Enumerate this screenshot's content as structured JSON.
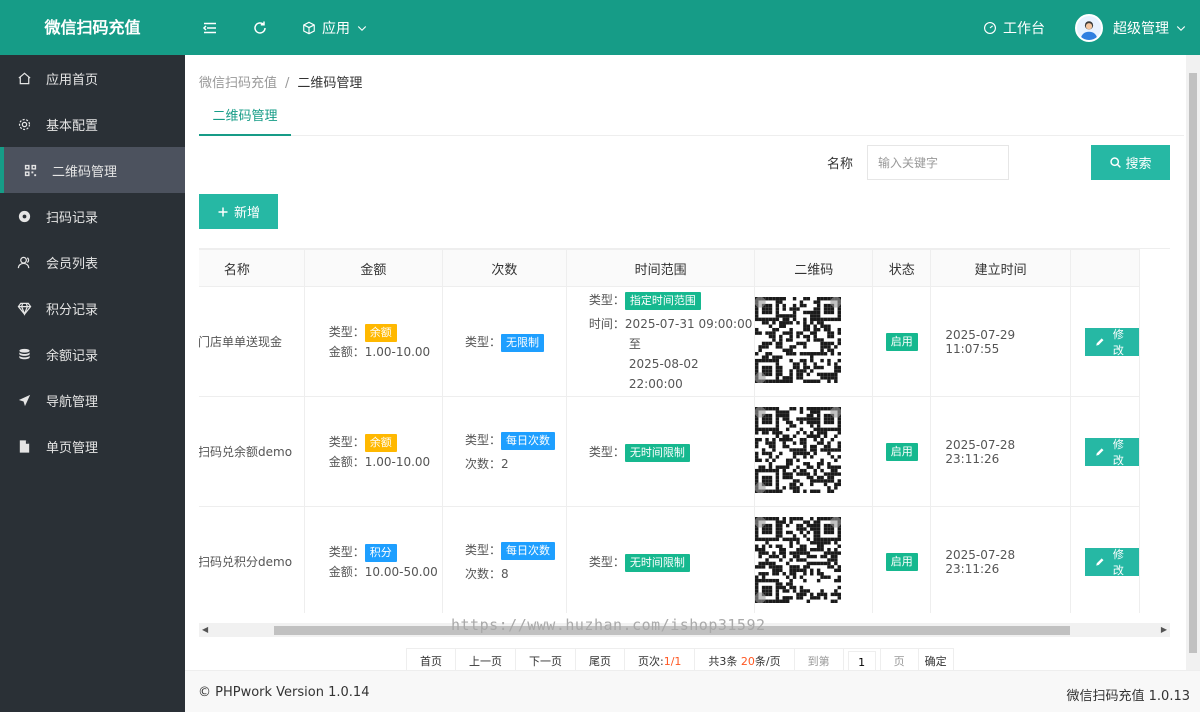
{
  "app": {
    "title": "微信扫码充值"
  },
  "topbar": {
    "app_menu": "应用",
    "workbench": "工作台",
    "user": "超级管理"
  },
  "sidebar": {
    "items": [
      {
        "label": "应用首页",
        "icon": "home-icon"
      },
      {
        "label": "基本配置",
        "icon": "gear-icon"
      },
      {
        "label": "二维码管理",
        "icon": "qrcode-icon",
        "active": true
      },
      {
        "label": "扫码记录",
        "icon": "disc-icon"
      },
      {
        "label": "会员列表",
        "icon": "user-icon"
      },
      {
        "label": "积分记录",
        "icon": "diamond-icon"
      },
      {
        "label": "余额记录",
        "icon": "coins-icon"
      },
      {
        "label": "导航管理",
        "icon": "navigation-icon"
      },
      {
        "label": "单页管理",
        "icon": "file-icon"
      }
    ]
  },
  "breadcrumb": {
    "root": "微信扫码充值",
    "sep": "/",
    "current": "二维码管理"
  },
  "tabs": [
    {
      "label": "二维码管理"
    }
  ],
  "search": {
    "label": "名称",
    "placeholder": "输入关键字",
    "button": "搜索"
  },
  "add_button": "新增",
  "table": {
    "headers": [
      "名称",
      "金额",
      "次数",
      "时间范围",
      "二维码",
      "状态",
      "建立时间",
      ""
    ],
    "rows": [
      {
        "name": "门店单单送现金",
        "amount_type_label": "类型：",
        "amount_type": "余额",
        "amount_label": "金额：",
        "amount": "1.00-10.00",
        "count_type_label": "类型：",
        "count_type": "无限制",
        "count_label": "",
        "count": "",
        "time_type_label": "类型：",
        "time_type": "指定时间范围",
        "time_label": "时间：",
        "time_start": "2025-07-31 09:00:00",
        "time_to": "至",
        "time_end": "2025-08-02 22:00:00",
        "status": "启用",
        "created": "2025-07-29 11:07:55",
        "action": "修改"
      },
      {
        "name": "扫码兑余额demo",
        "amount_type_label": "类型：",
        "amount_type": "余额",
        "amount_label": "金额：",
        "amount": "1.00-10.00",
        "count_type_label": "类型：",
        "count_type": "每日次数",
        "count_label": "次数：",
        "count": "2",
        "time_type_label": "类型：",
        "time_type": "无时间限制",
        "time_label": "",
        "time_start": "",
        "time_to": "",
        "time_end": "",
        "status": "启用",
        "created": "2025-07-28 23:11:26",
        "action": "修改"
      },
      {
        "name": "扫码兑积分demo",
        "amount_type_label": "类型：",
        "amount_type": "积分",
        "amount_label": "金额：",
        "amount": "10.00-50.00",
        "count_type_label": "类型：",
        "count_type": "每日次数",
        "count_label": "次数：",
        "count": "8",
        "time_type_label": "类型：",
        "time_type": "无时间限制",
        "time_label": "",
        "time_start": "",
        "time_to": "",
        "time_end": "",
        "status": "启用",
        "created": "2025-07-28 23:11:26",
        "action": "修改"
      }
    ]
  },
  "pager": {
    "first": "首页",
    "prev": "上一页",
    "next": "下一页",
    "last": "尾页",
    "page_label": "页次:",
    "page_value": "1/1",
    "total_prefix": "共3条 ",
    "per_page": "20",
    "per_page_suffix": "条/页",
    "goto": "到第",
    "goto_value": "1",
    "page_unit": "页",
    "confirm": "确定"
  },
  "watermark": "https://www.huzhan.com/ishop31592",
  "footer": {
    "left": "© PHPwork Version 1.0.14",
    "right": "微信扫码充值 1.0.13"
  },
  "colors": {
    "brand": "#169c87",
    "sidebar": "#2a3036",
    "button": "#26b8a4",
    "badge_orange": "#ffb800",
    "badge_blue": "#1e9fff",
    "badge_green": "#16b88f"
  }
}
